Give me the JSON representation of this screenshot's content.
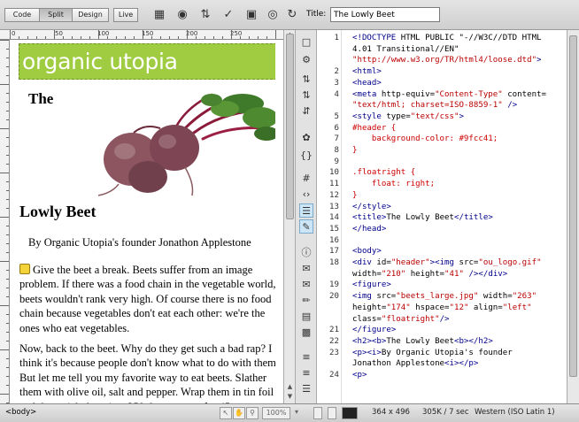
{
  "toolbar": {
    "views": [
      "Code",
      "Split",
      "Design",
      "Live"
    ],
    "active_view": "Split",
    "title_label": "Title:",
    "title_value": "The Lowly Beet",
    "icons": [
      "multiscreen-icon",
      "preview-globe-icon",
      "file-management-icon",
      "check-browser-icon",
      "inspect-icon",
      "visual-aids-icon",
      "refresh-icon"
    ]
  },
  "ruler": {
    "marks": [
      "0",
      "50",
      "100",
      "150",
      "200",
      "250"
    ]
  },
  "design": {
    "header_text": "organic utopia",
    "heading_part1": "The",
    "heading_part2": "Lowly Beet",
    "byline": "By Organic Utopia's founder Jonathon Applestone",
    "paragraph1": "Give the beet a break. Beets suffer from an image problem. If there was a food chain in the vegetable world, beets wouldn't rank very high. Of course there is no food chain because vegetables don't eat each other: we're the ones who eat vegetables.",
    "paragraph2": "Now, back to the beet. Why do they get such a bad rap? I think it's because people don't know what to do with them. But let me tell you my favorite way to eat beets. Slather them with olive oil, salt and pepper. Wrap them in tin foil and then stick them in a 350 degree oven for 45"
  },
  "code": {
    "line_numbers": [
      "1",
      "",
      "",
      "2",
      "3",
      "4",
      "",
      "5",
      "6",
      "7",
      "8",
      "9",
      "10",
      "11",
      "12",
      "13",
      "14",
      "15",
      "16",
      "17",
      "18",
      "",
      "19",
      "20",
      "",
      "",
      "21",
      "22",
      "23",
      "",
      "24"
    ],
    "lines": [
      "<!DOCTYPE HTML PUBLIC \"-//W3C//DTD HTML",
      "4.01 Transitional//EN\"",
      "\"http://www.w3.org/TR/html4/loose.dtd\">",
      "<html>",
      "<head>",
      "<meta http-equiv=\"Content-Type\" content=",
      "\"text/html; charset=ISO-8859-1\" />",
      "<style type=\"text/css\">",
      "#header {",
      "    background-color: #9fcc41;",
      "}",
      "",
      ".floatright {",
      "    float: right;",
      "}",
      "</style>",
      "<title>The Lowly Beet</title>",
      "</head>",
      "",
      "<body>",
      "<div id=\"header\"><img src=\"ou_logo.gif\"",
      "width=\"210\" height=\"41\" /></div>",
      "<figure>",
      "<img src=\"beets_large.jpg\" width=\"263\"",
      "height=\"174\" hspace=\"12\" align=\"left\"",
      "class=\"floatright\"/>",
      "</figure>",
      "<h2><b>The Lowly Beet<b></h2>",
      "<p><i>By Organic Utopia's founder",
      "Jonathon Applestone<i></p>",
      "<p>"
    ]
  },
  "status": {
    "tag": "<body>",
    "zoom": "100%",
    "dimensions": "364 x 496",
    "size_time": "305K / 7 sec",
    "encoding": "Western (ISO Latin 1)"
  }
}
